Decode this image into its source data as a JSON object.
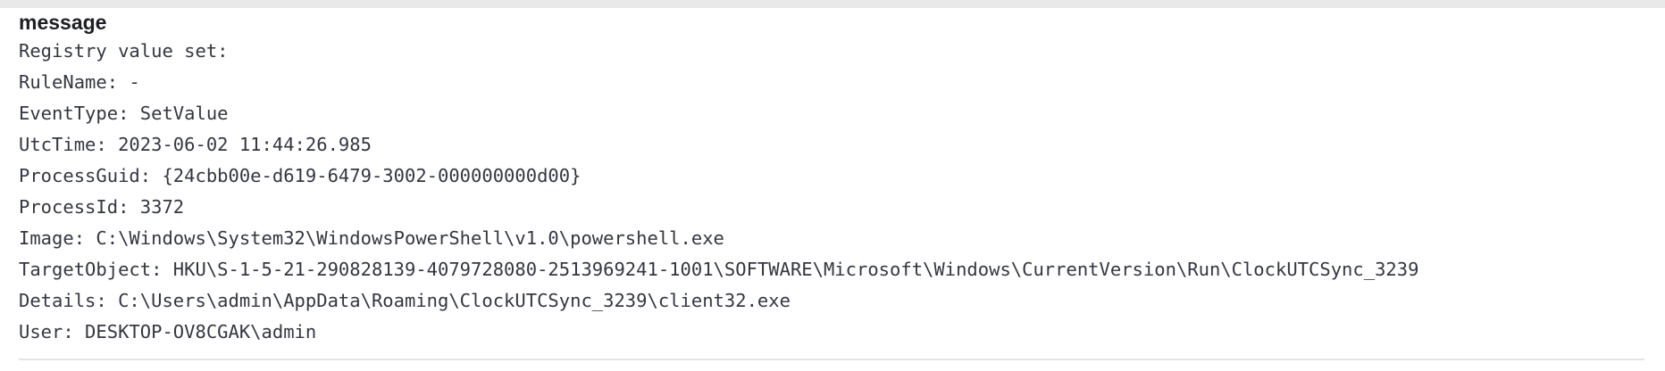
{
  "field": {
    "name": "message",
    "lines": [
      "Registry value set:",
      "RuleName: -",
      "EventType: SetValue",
      "UtcTime: 2023-06-02 11:44:26.985",
      "ProcessGuid: {24cbb00e-d619-6479-3002-000000000d00}",
      "ProcessId: 3372",
      "Image: C:\\Windows\\System32\\WindowsPowerShell\\v1.0\\powershell.exe",
      "TargetObject: HKU\\S-1-5-21-290828139-4079728080-2513969241-1001\\SOFTWARE\\Microsoft\\Windows\\CurrentVersion\\Run\\ClockUTCSync_3239",
      "Details: C:\\Users\\admin\\AppData\\Roaming\\ClockUTCSync_3239\\client32.exe",
      "User: DESKTOP-OV8CGAK\\admin"
    ]
  }
}
